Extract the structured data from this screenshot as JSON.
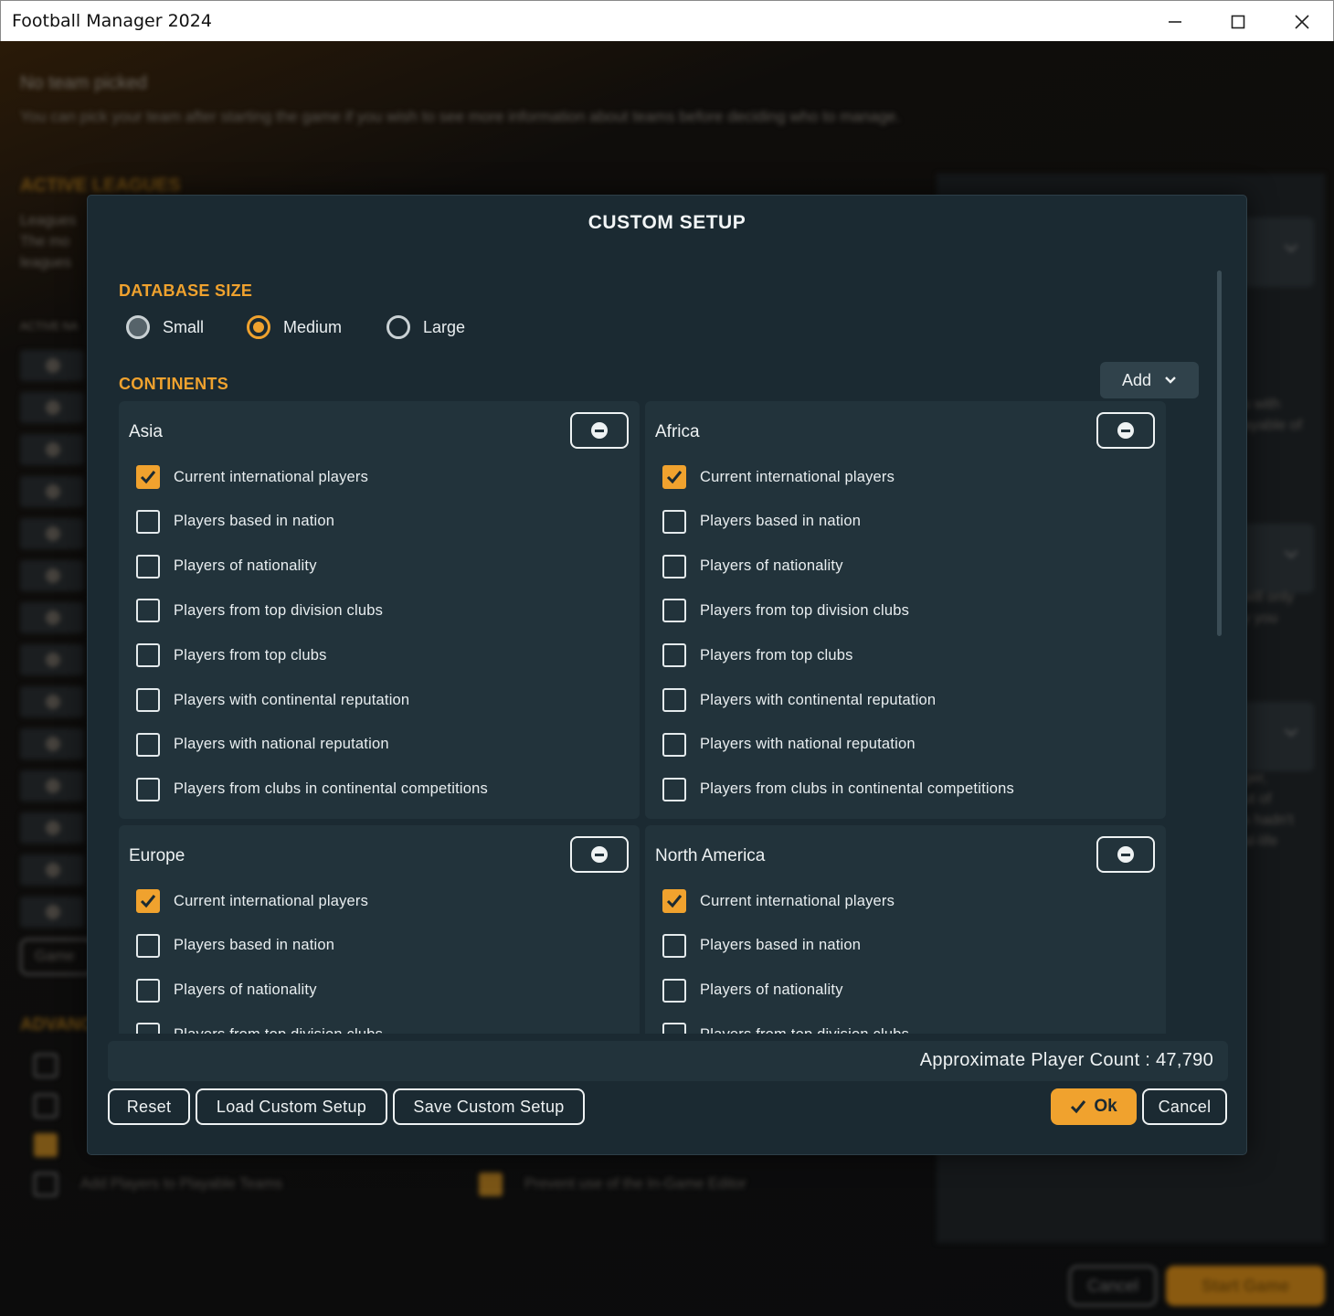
{
  "window": {
    "title": "Football Manager 2024",
    "minimize_icon": "minimize-icon",
    "maximize_icon": "maximize-icon",
    "close_icon": "close-icon"
  },
  "background": {
    "heading": "No team picked",
    "subheading": "You can pick your team after starting the game if you wish to see more information about teams before deciding who to manage.",
    "active_leagues": "ACTIVE LEAGUES",
    "leagues_text": [
      "Leagues",
      "The mo",
      "leagues"
    ],
    "active_nations": "ACTIVE NA",
    "game_button": "Game",
    "advanced": "ADVANC",
    "add_players_label": "Add Players to Playable Teams",
    "prevent_editor_label": "Prevent use of the In-Game Editor",
    "right_text_1": [
      "s with",
      "ayable of"
    ],
    "right_text_2": [
      "will only",
      "y you"
    ],
    "right_text_3": [
      "ger,",
      "ut of",
      "s hadn't",
      "al-life"
    ],
    "cancel_button": "Cancel",
    "start_button": "Start Game"
  },
  "modal": {
    "title": "CUSTOM SETUP",
    "database_size": {
      "label": "DATABASE SIZE",
      "options": [
        "Small",
        "Medium",
        "Large"
      ],
      "selected": "Medium"
    },
    "continents_label": "CONTINENTS",
    "add_button": "Add",
    "panels": [
      {
        "name": "Asia",
        "options": [
          {
            "label": "Current international players",
            "checked": true
          },
          {
            "label": "Players based in nation",
            "checked": false
          },
          {
            "label": "Players of nationality",
            "checked": false
          },
          {
            "label": "Players from top division clubs",
            "checked": false
          },
          {
            "label": "Players from top clubs",
            "checked": false
          },
          {
            "label": "Players with continental reputation",
            "checked": false
          },
          {
            "label": "Players with national reputation",
            "checked": false
          },
          {
            "label": "Players from clubs in continental competitions",
            "checked": false
          }
        ]
      },
      {
        "name": "Africa",
        "options": [
          {
            "label": "Current international players",
            "checked": true
          },
          {
            "label": "Players based in nation",
            "checked": false
          },
          {
            "label": "Players of nationality",
            "checked": false
          },
          {
            "label": "Players from top division clubs",
            "checked": false
          },
          {
            "label": "Players from top clubs",
            "checked": false
          },
          {
            "label": "Players with continental reputation",
            "checked": false
          },
          {
            "label": "Players with national reputation",
            "checked": false
          },
          {
            "label": "Players from clubs in continental competitions",
            "checked": false
          }
        ]
      },
      {
        "name": "Europe",
        "options": [
          {
            "label": "Current international players",
            "checked": true
          },
          {
            "label": "Players based in nation",
            "checked": false
          },
          {
            "label": "Players of nationality",
            "checked": false
          },
          {
            "label": "Players from top division clubs",
            "checked": false
          }
        ]
      },
      {
        "name": "North America",
        "options": [
          {
            "label": "Current international players",
            "checked": true
          },
          {
            "label": "Players based in nation",
            "checked": false
          },
          {
            "label": "Players of nationality",
            "checked": false
          },
          {
            "label": "Players from top division clubs",
            "checked": false
          }
        ]
      }
    ],
    "player_count": "Approximate Player Count : 47,790",
    "buttons": {
      "reset": "Reset",
      "load": "Load Custom Setup",
      "save": "Save Custom Setup",
      "ok": "Ok",
      "cancel": "Cancel"
    },
    "colors": {
      "accent": "#f0a22e",
      "panel": "#22333b",
      "modal": "#1b2a32"
    }
  }
}
